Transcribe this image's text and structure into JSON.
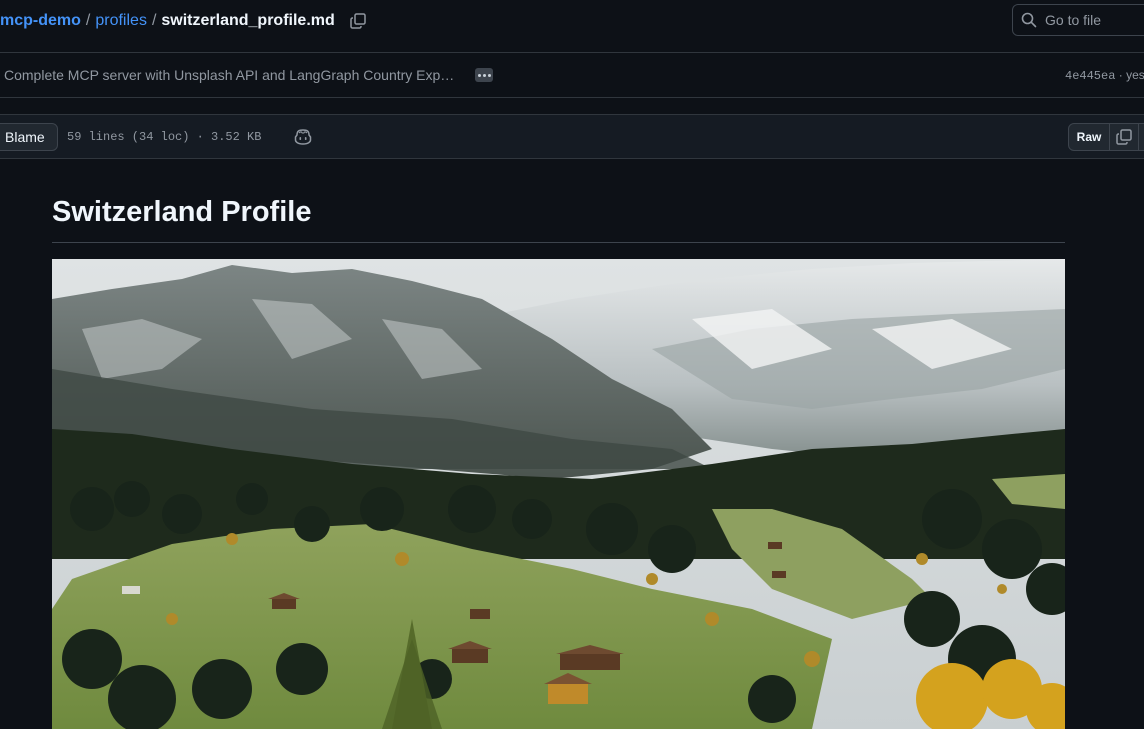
{
  "breadcrumb": {
    "repo": "mcp-demo",
    "folder": "profiles",
    "file": "switzerland_profile.md",
    "separator": "/"
  },
  "search": {
    "placeholder": "Go to file"
  },
  "commit": {
    "message": "Complete MCP server with Unsplash API and LangGraph Country Exp…",
    "sha": "4e445ea",
    "time": "· yes"
  },
  "file_header": {
    "blame_label": "Blame",
    "stats": "59 lines (34 loc) · 3.52 KB",
    "raw_label": "Raw"
  },
  "document": {
    "title": "Switzerland Profile",
    "image_subject": "Swiss alpine valley with snowy mountains, forests, meadows and chalets"
  },
  "colors": {
    "background": "#0d1117",
    "link": "#4493f8",
    "muted": "#9198a1",
    "border": "#30363d"
  },
  "icons": [
    "copy-icon",
    "search-icon",
    "kebab-icon",
    "copilot-icon",
    "copy-raw-icon",
    "download-icon"
  ]
}
